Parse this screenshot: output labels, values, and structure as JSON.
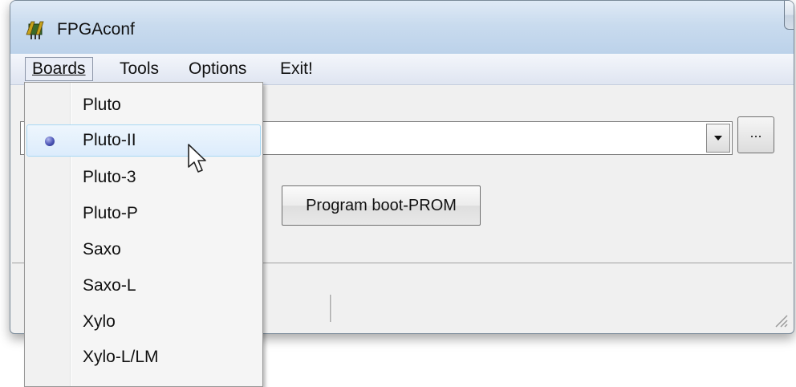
{
  "window": {
    "title": "FPGAconf",
    "icon": "fpga-chip-icon"
  },
  "menubar": {
    "items": [
      {
        "label": "Boards",
        "state": "open"
      },
      {
        "label": "Tools"
      },
      {
        "label": "Options"
      },
      {
        "label": "Exit!"
      }
    ]
  },
  "main": {
    "combo_value": "",
    "browse_label": "...",
    "program_button_label": "Program boot-PROM"
  },
  "boards_menu": {
    "items": [
      {
        "label": "Pluto",
        "selected": false
      },
      {
        "label": "Pluto-II",
        "selected": true,
        "hovered": true
      },
      {
        "label": "Pluto-3",
        "selected": false
      },
      {
        "label": "Pluto-P",
        "selected": false
      },
      {
        "label": "Saxo",
        "selected": false
      },
      {
        "label": "Saxo-L",
        "selected": false
      },
      {
        "label": "Xylo",
        "selected": false
      },
      {
        "label": "Xylo-L/LM",
        "selected": false
      }
    ]
  },
  "colors": {
    "accent_radio": "#4c55b6",
    "close_button": "#c23b22",
    "hover_border": "#a8d8f4"
  }
}
